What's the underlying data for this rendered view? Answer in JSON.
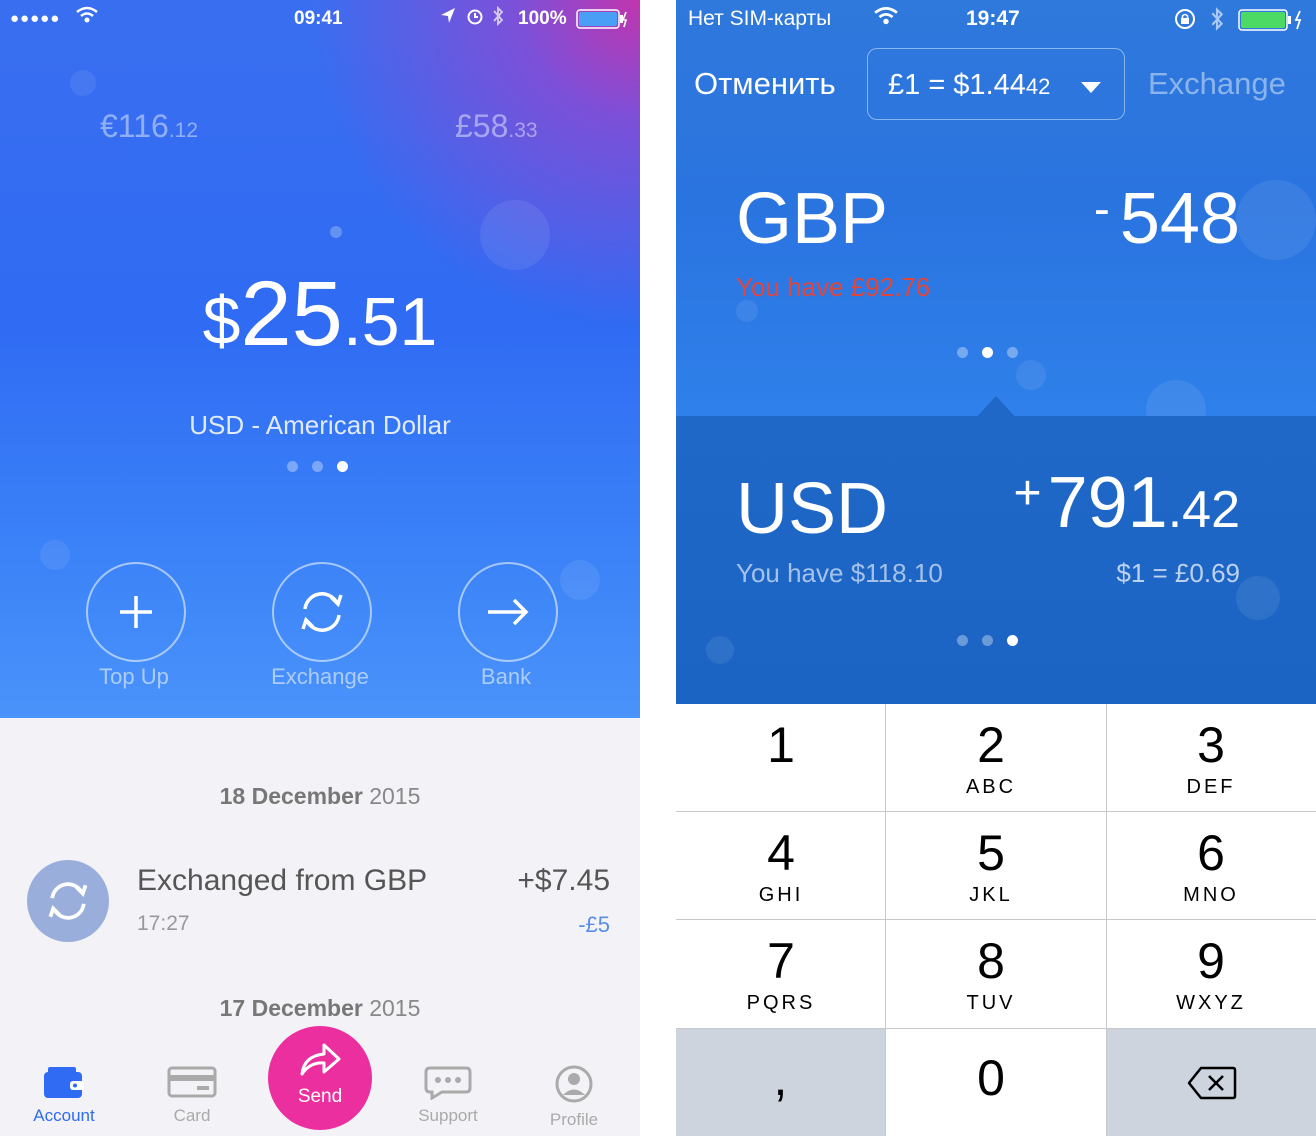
{
  "left": {
    "status": {
      "carrier_dots": "●●●●●",
      "time": "09:41",
      "battery": "100%"
    },
    "balances": {
      "eur_int": "€116",
      "eur_dec": ".12",
      "gbp_int": "£58",
      "gbp_dec": ".33"
    },
    "main_balance": {
      "currency": "$",
      "integer": "25",
      "decimal": ".51"
    },
    "currency_desc": "USD - American Dollar",
    "page_dots": {
      "count": 3,
      "active": 2
    },
    "actions": [
      {
        "label": "Top Up",
        "icon": "plus-icon"
      },
      {
        "label": "Exchange",
        "icon": "exchange-icon"
      },
      {
        "label": "Bank",
        "icon": "arrow-right-icon"
      }
    ],
    "dates": [
      {
        "day": "18 December",
        "year": "2015"
      },
      {
        "day": "17 December",
        "year": "2015"
      }
    ],
    "transaction": {
      "title": "Exchanged from GBP",
      "time": "17:27",
      "amount": "+$7.45",
      "sub_amount": "-£5",
      "icon": "exchange-icon"
    },
    "tabs": [
      {
        "label": "Account",
        "icon": "wallet-icon",
        "active": true
      },
      {
        "label": "Card",
        "icon": "card-icon",
        "active": false
      },
      {
        "label": "Support",
        "icon": "chat-icon",
        "active": false
      },
      {
        "label": "Profile",
        "icon": "profile-icon",
        "active": false
      }
    ],
    "send_label": "Send",
    "colors": {
      "accent": "#2f6bf3",
      "send": "#ec2f9f",
      "negative": "#5b8ee8"
    }
  },
  "right": {
    "status": {
      "carrier": "Нет SIM-карты",
      "time": "19:47"
    },
    "cancel_label": "Отменить",
    "rate": {
      "text": "£1 = $1.44",
      "small": "42"
    },
    "exchange_label": "Exchange",
    "from": {
      "currency": "GBP",
      "amount": "548",
      "sign": "-",
      "have_label": "You have",
      "have_value": "£92.76"
    },
    "to": {
      "currency": "USD",
      "sign": "+",
      "amount_int": "791",
      "amount_dec": ".42",
      "have_label": "You have",
      "have_value": "$118.10",
      "rate": "$1 = £0.69"
    },
    "from_dots": {
      "count": 3,
      "active": 1
    },
    "to_dots": {
      "count": 3,
      "active": 2
    },
    "keypad": [
      {
        "n": "1",
        "l": ""
      },
      {
        "n": "2",
        "l": "ABC"
      },
      {
        "n": "3",
        "l": "DEF"
      },
      {
        "n": "4",
        "l": "GHI"
      },
      {
        "n": "5",
        "l": "JKL"
      },
      {
        "n": "6",
        "l": "MNO"
      },
      {
        "n": "7",
        "l": "PQRS"
      },
      {
        "n": "8",
        "l": "TUV"
      },
      {
        "n": "9",
        "l": "WXYZ"
      },
      {
        "n": ",",
        "l": ""
      },
      {
        "n": "0",
        "l": ""
      },
      {
        "n": "",
        "l": "",
        "icon": "backspace-icon"
      }
    ],
    "colors": {
      "warning": "#e0463c"
    }
  }
}
